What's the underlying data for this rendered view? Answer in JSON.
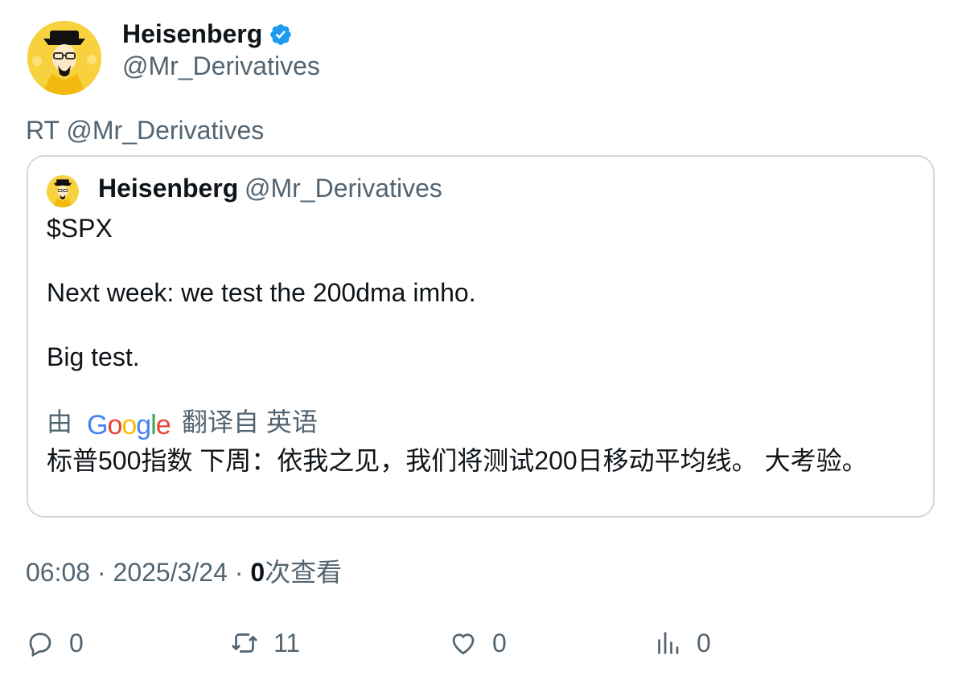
{
  "author": {
    "name": "Heisenberg",
    "handle": "@Mr_Derivatives",
    "verified": true,
    "avatar_icon": "heisenberg-avatar",
    "verified_icon": "verified-badge-icon"
  },
  "retweet_label": "RT @Mr_Derivatives",
  "quote": {
    "name": "Heisenberg",
    "handle": "@Mr_Derivatives",
    "lines": [
      "$SPX",
      "Next week: we test the 200dma imho.",
      "Big test."
    ]
  },
  "translation": {
    "by": "由",
    "provider": "Google",
    "from": "翻译自 英语",
    "text": "标普500指数 下周：依我之见，我们将测试200日移动平均线。 大考验。"
  },
  "meta": {
    "time": "06:08",
    "separator": "·",
    "date": "2025/3/24",
    "views_count": "0",
    "views_label": "次查看"
  },
  "actions": {
    "replies": "0",
    "retweets": "11",
    "likes": "0",
    "views": "0"
  },
  "colors": {
    "text": "#0f1419",
    "secondary": "#536471",
    "border": "#cfd9de",
    "verified": "#1d9bf0",
    "avatar_bg": "#f7d23e"
  }
}
